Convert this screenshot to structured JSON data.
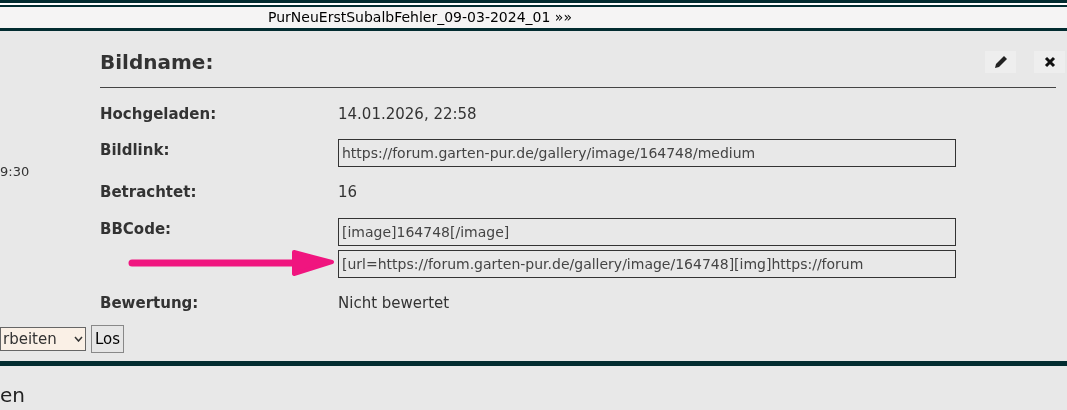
{
  "nav": {
    "next_link": "PurNeuErstSubalbFehler_09-03-2024_01 »»"
  },
  "sidebar": {
    "time": "9:30"
  },
  "detail": {
    "title": "Bildname:",
    "rows": [
      {
        "kind": "text",
        "label": "Hochgeladen:",
        "value": "14.01.2026, 22:58"
      },
      {
        "kind": "fields",
        "label": "Bildlink:",
        "fields": [
          "https://forum.garten-pur.de/gallery/image/164748/medium"
        ]
      },
      {
        "kind": "text",
        "label": "Betrachtet:",
        "value": "16"
      },
      {
        "kind": "fields",
        "label": "BBCode:",
        "fields": [
          "[image]164748[/image]",
          "[url=https://forum.garten-pur.de/gallery/image/164748][img]https://forum"
        ],
        "arrow": true
      },
      {
        "kind": "text",
        "label": "Bewertung:",
        "value": "Nicht bewertet"
      }
    ]
  },
  "action": {
    "select_value": "rbeiten",
    "button": "Los"
  },
  "footer": {
    "heading": "en"
  }
}
